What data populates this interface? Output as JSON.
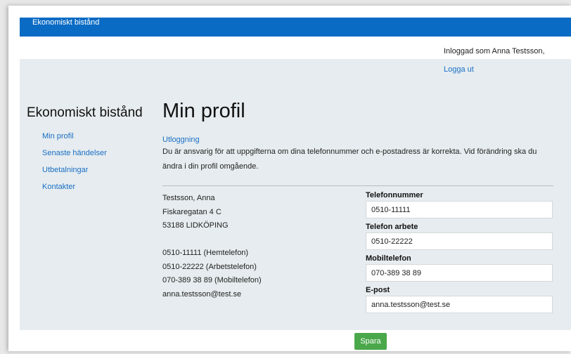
{
  "header": {
    "brand": "Ekonomiskt bistånd"
  },
  "user": {
    "logged_in_text": "Inloggad som Anna Testsson,",
    "logout_label": "Logga ut"
  },
  "sidebar": {
    "title": "Ekonomiskt bistånd",
    "items": [
      {
        "label": "Min profil"
      },
      {
        "label": "Senaste händelser"
      },
      {
        "label": "Utbetalningar"
      },
      {
        "label": "Kontakter"
      }
    ]
  },
  "main": {
    "title": "Min profil",
    "logout_link": "Utloggning",
    "info": "Du är ansvarig för att uppgifterna om dina telefonnummer och e-postadress är korrekta. Vid förändring ska du ändra i din profil omgående.",
    "address": {
      "name": "Testsson, Anna",
      "street": "Fiskaregatan 4 C",
      "city": "53188 LIDKÖPING",
      "home_phone": "0510-11111 (Hemtelefon)",
      "work_phone": "0510-22222 (Arbetstelefon)",
      "mobile_phone": "070-389 38 89 (Mobiltelefon)",
      "email": "anna.testsson@test.se"
    },
    "form": {
      "phone_label": "Telefonnummer",
      "phone_value": "0510-11111",
      "work_label": "Telefon arbete",
      "work_value": "0510-22222",
      "mobile_label": "Mobiltelefon",
      "mobile_value": "070-389 38 89",
      "email_label": "E-post",
      "email_value": "anna.testsson@test.se",
      "save_label": "Spara"
    }
  },
  "colors": {
    "topbar": "#0a6bc4",
    "link": "#1a6fc4",
    "content_bg": "#e6ecef",
    "save_button": "#4aa84a"
  }
}
